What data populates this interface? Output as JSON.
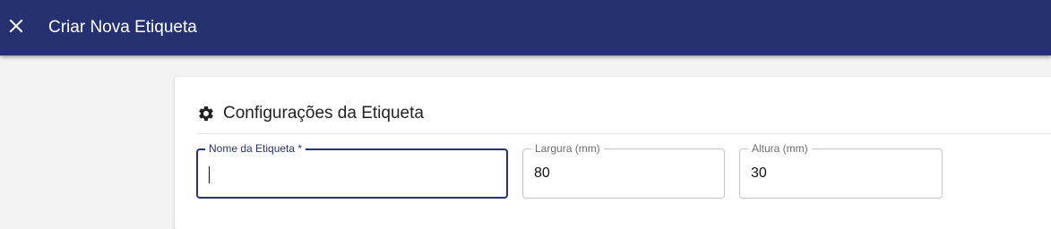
{
  "appbar": {
    "title": "Criar Nova Etiqueta",
    "close_icon": "close-icon",
    "background": "#263270"
  },
  "section": {
    "icon": "gear-icon",
    "title": "Configurações da Etiqueta"
  },
  "fields": {
    "name": {
      "label": "Nome da Etiqueta *",
      "value": ""
    },
    "width": {
      "label": "Largura (mm)",
      "value": "80"
    },
    "height": {
      "label": "Altura (mm)",
      "value": "30"
    }
  },
  "accent": "#263270"
}
